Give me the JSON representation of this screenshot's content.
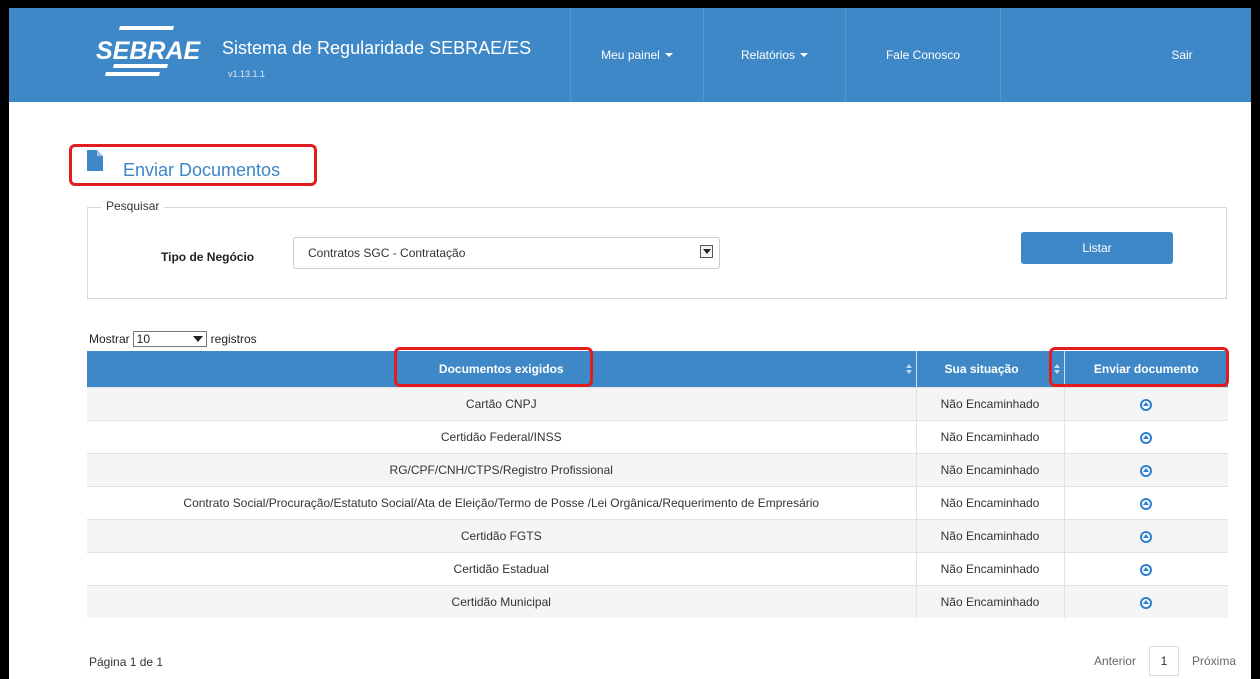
{
  "header": {
    "logo_text": "SEBRAE",
    "title": "Sistema de Regularidade SEBRAE/ES",
    "version": "v1.13.1.1",
    "nav": {
      "meu_painel": "Meu painel",
      "relatorios": "Relatórios",
      "fale_conosco": "Fale Conosco",
      "sair": "Sair"
    }
  },
  "page": {
    "title": "Enviar Documentos",
    "icon": "document-icon"
  },
  "search": {
    "legend": "Pesquisar",
    "tipo_label": "Tipo de Negócio",
    "tipo_value": "Contratos SGC - Contratação",
    "listar_label": "Listar"
  },
  "length": {
    "prefix": "Mostrar",
    "value": "10",
    "suffix": "registros"
  },
  "table": {
    "headers": {
      "documentos": "Documentos exigidos",
      "situacao": "Sua situação",
      "enviar": "Enviar documento"
    },
    "rows": [
      {
        "documento": "Cartão CNPJ",
        "situacao": "Não Encaminhado"
      },
      {
        "documento": "Certidão Federal/INSS",
        "situacao": "Não Encaminhado"
      },
      {
        "documento": "RG/CPF/CNH/CTPS/Registro Profissional",
        "situacao": "Não Encaminhado"
      },
      {
        "documento": "Contrato Social/Procuração/Estatuto Social/Ata de Eleição/Termo de Posse /Lei Orgânica/Requerimento de Empresário",
        "situacao": "Não Encaminhado"
      },
      {
        "documento": "Certidão FGTS",
        "situacao": "Não Encaminhado"
      },
      {
        "documento": "Certidão Estadual",
        "situacao": "Não Encaminhado"
      },
      {
        "documento": "Certidão Municipal",
        "situacao": "Não Encaminhado"
      }
    ]
  },
  "footer": {
    "page_info": "Página 1 de 1",
    "prev": "Anterior",
    "page_num": "1",
    "next": "Próxima"
  },
  "colors": {
    "primary": "#3f88c8",
    "highlight": "#e21d1d",
    "title_text": "#3c86c6"
  }
}
